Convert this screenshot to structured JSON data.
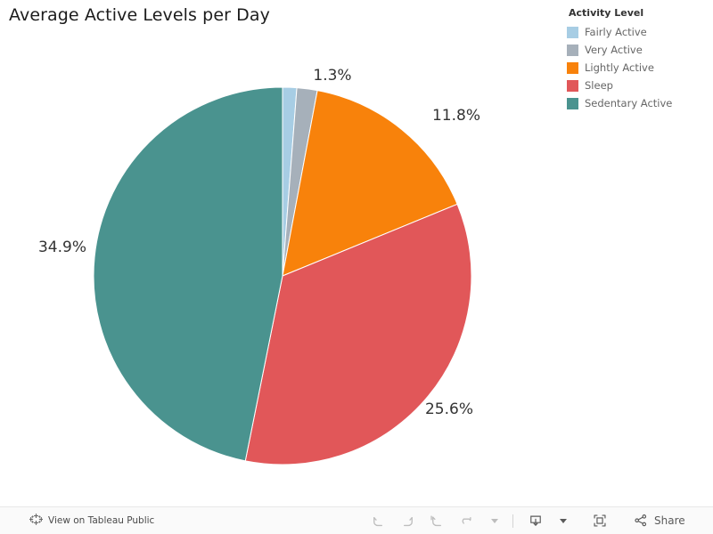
{
  "title": "Average Active Levels per Day",
  "legend": {
    "title": "Activity Level",
    "items": [
      {
        "label": "Fairly Active",
        "color": "#a7cde4"
      },
      {
        "label": "Very Active",
        "color": "#a6b0ba"
      },
      {
        "label": "Lightly Active",
        "color": "#f8820b"
      },
      {
        "label": "Sleep",
        "color": "#e15759"
      },
      {
        "label": "Sedentary Active",
        "color": "#4a938f"
      }
    ]
  },
  "chart_data": {
    "type": "pie",
    "title": "Average Active Levels per Day",
    "legend_title": "Activity Level",
    "legend_position": "right",
    "value_unit": "percent",
    "start_angle_deg": 0,
    "direction": "clockwise",
    "categories": [
      "Fairly Active",
      "Very Active",
      "Lightly Active",
      "Sleep",
      "Sedentary Active"
    ],
    "values": [
      0.9,
      1.3,
      11.8,
      25.6,
      34.9
    ],
    "colors": [
      "#a7cde4",
      "#a6b0ba",
      "#f8820b",
      "#e15759",
      "#4a938f"
    ],
    "slices": [
      {
        "label": "Fairly Active",
        "value": 0.9,
        "display": "",
        "color": "#a7cde4",
        "label_shown": false
      },
      {
        "label": "Very Active",
        "value": 1.3,
        "display": "1.3%",
        "color": "#a6b0ba",
        "label_shown": true
      },
      {
        "label": "Lightly Active",
        "value": 11.8,
        "display": "11.8%",
        "color": "#f8820b",
        "label_shown": true
      },
      {
        "label": "Sleep",
        "value": 25.6,
        "display": "25.6%",
        "color": "#e15759",
        "label_shown": true
      },
      {
        "label": "Sedentary Active",
        "value": 34.9,
        "display": "34.9%",
        "color": "#4a938f",
        "label_shown": true
      }
    ],
    "data_labels": [
      "1.3%",
      "11.8%",
      "25.6%",
      "34.9%"
    ]
  },
  "labels": {
    "very_active": "1.3%",
    "lightly_active": "11.8%",
    "sleep": "25.6%",
    "sedentary_active": "34.9%"
  },
  "toolbar": {
    "view_on_tableau_public": "View on Tableau Public",
    "undo": "Undo",
    "redo": "Redo",
    "revert": "Revert",
    "refresh": "Refresh",
    "download": "Download",
    "fullscreen": "Full Screen",
    "share": "Share"
  }
}
